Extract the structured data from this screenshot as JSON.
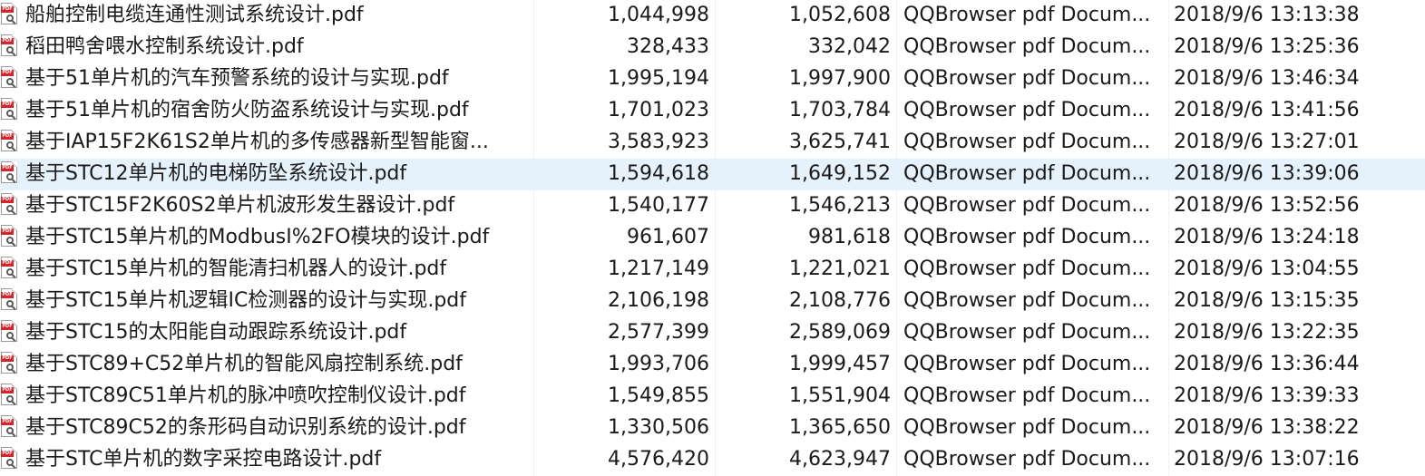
{
  "icon": "pdf-file-icon",
  "files": [
    {
      "name": "船舶控制电缆连通性测试系统设计.pdf",
      "size": "1,044,998",
      "packed": "1,052,608",
      "type": "QQBrowser pdf Docum...",
      "modified": "2018/9/6 13:13:38"
    },
    {
      "name": "稻田鸭舍喂水控制系统设计.pdf",
      "size": "328,433",
      "packed": "332,042",
      "type": "QQBrowser pdf Docum...",
      "modified": "2018/9/6 13:25:36"
    },
    {
      "name": "基于51单片机的汽车预警系统的设计与实现.pdf",
      "size": "1,995,194",
      "packed": "1,997,900",
      "type": "QQBrowser pdf Docum...",
      "modified": "2018/9/6 13:46:34"
    },
    {
      "name": "基于51单片机的宿舍防火防盗系统设计与实现.pdf",
      "size": "1,701,023",
      "packed": "1,703,784",
      "type": "QQBrowser pdf Docum...",
      "modified": "2018/9/6 13:41:56"
    },
    {
      "name": "基于IAP15F2K61S2单片机的多传感器新型智能窗...",
      "size": "3,583,923",
      "packed": "3,625,741",
      "type": "QQBrowser pdf Docum...",
      "modified": "2018/9/6 13:27:01"
    },
    {
      "name": "基于STC12单片机的电梯防坠系统设计.pdf",
      "size": "1,594,618",
      "packed": "1,649,152",
      "type": "QQBrowser pdf Docum...",
      "modified": "2018/9/6 13:39:06"
    },
    {
      "name": "基于STC15F2K60S2单片机波形发生器设计.pdf",
      "size": "1,540,177",
      "packed": "1,546,213",
      "type": "QQBrowser pdf Docum...",
      "modified": "2018/9/6 13:52:56"
    },
    {
      "name": "基于STC15单片机的ModbusI%2FO模块的设计.pdf",
      "size": "961,607",
      "packed": "981,618",
      "type": "QQBrowser pdf Docum...",
      "modified": "2018/9/6 13:24:18"
    },
    {
      "name": "基于STC15单片机的智能清扫机器人的设计.pdf",
      "size": "1,217,149",
      "packed": "1,221,021",
      "type": "QQBrowser pdf Docum...",
      "modified": "2018/9/6 13:04:55"
    },
    {
      "name": "基于STC15单片机逻辑IC检测器的设计与实现.pdf",
      "size": "2,106,198",
      "packed": "2,108,776",
      "type": "QQBrowser pdf Docum...",
      "modified": "2018/9/6 13:15:35"
    },
    {
      "name": "基于STC15的太阳能自动跟踪系统设计.pdf",
      "size": "2,577,399",
      "packed": "2,589,069",
      "type": "QQBrowser pdf Docum...",
      "modified": "2018/9/6 13:22:35"
    },
    {
      "name": "基于STC89+C52单片机的智能风扇控制系统.pdf",
      "size": "1,993,706",
      "packed": "1,999,457",
      "type": "QQBrowser pdf Docum...",
      "modified": "2018/9/6 13:36:44"
    },
    {
      "name": "基于STC89C51单片机的脉冲喷吹控制仪设计.pdf",
      "size": "1,549,855",
      "packed": "1,551,904",
      "type": "QQBrowser pdf Docum...",
      "modified": "2018/9/6 13:39:33"
    },
    {
      "name": "基于STC89C52的条形码自动识别系统的设计.pdf",
      "size": "1,330,506",
      "packed": "1,365,650",
      "type": "QQBrowser pdf Docum...",
      "modified": "2018/9/6 13:38:22"
    },
    {
      "name": "基于STC单片机的数字采控电路设计.pdf",
      "size": "4,576,420",
      "packed": "4,623,947",
      "type": "QQBrowser pdf Docum...",
      "modified": "2018/9/6 13:07:16"
    }
  ],
  "selected_index": 5,
  "colors": {
    "selected_row": "#e5f1fb",
    "pdf_badge": "#d3262c",
    "text": "#1a1a1a"
  }
}
